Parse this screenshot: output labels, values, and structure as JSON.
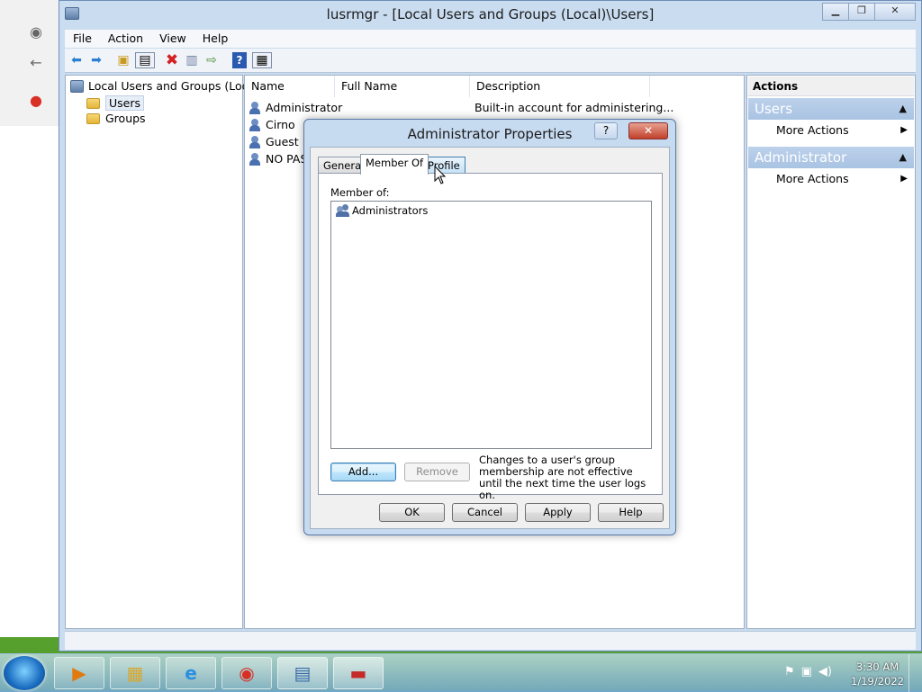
{
  "window": {
    "title": "lusrmgr - [Local Users and Groups (Local)\\Users]"
  },
  "menubar": [
    "File",
    "Action",
    "View",
    "Help"
  ],
  "tree": {
    "root": "Local Users and Groups (Local)",
    "items": [
      "Users",
      "Groups"
    ]
  },
  "list": {
    "columns": [
      "Name",
      "Full Name",
      "Description"
    ],
    "rows": [
      {
        "name": "Administrator",
        "full_name": "",
        "description": "Built-in account for administering..."
      },
      {
        "name": "Cirno",
        "full_name": "",
        "description": ""
      },
      {
        "name": "Guest",
        "full_name": "",
        "description": ""
      },
      {
        "name": "NO PAS",
        "full_name": "",
        "description": ""
      }
    ]
  },
  "actions": {
    "header": "Actions",
    "sections": [
      {
        "title": "Users",
        "item": "More Actions"
      },
      {
        "title": "Administrator",
        "item": "More Actions"
      }
    ]
  },
  "dialog": {
    "title": "Administrator Properties",
    "help_glyph": "?",
    "close_glyph": "✕",
    "tabs": [
      "General",
      "Member Of",
      "Profile"
    ],
    "active_tab": "Member Of",
    "member_of_label": "Member of:",
    "members": [
      "Administrators"
    ],
    "add_label": "Add...",
    "remove_label": "Remove",
    "note": "Changes to a user's group membership are not effective until the next time the user logs on.",
    "buttons": {
      "ok": "OK",
      "cancel": "Cancel",
      "apply": "Apply",
      "help": "Help"
    }
  },
  "taskbar": {
    "time": "3:30 AM",
    "date": "1/19/2022"
  },
  "colors": {
    "accent": "#3c7fb1",
    "actions_section": "#a9c3e3",
    "delete_red": "#d42020"
  },
  "icons": [
    "back-icon",
    "forward-icon",
    "up-folder-icon",
    "show-hide-tree-icon",
    "delete-icon",
    "properties-icon",
    "export-icon",
    "help-icon",
    "action-pane-icon"
  ]
}
